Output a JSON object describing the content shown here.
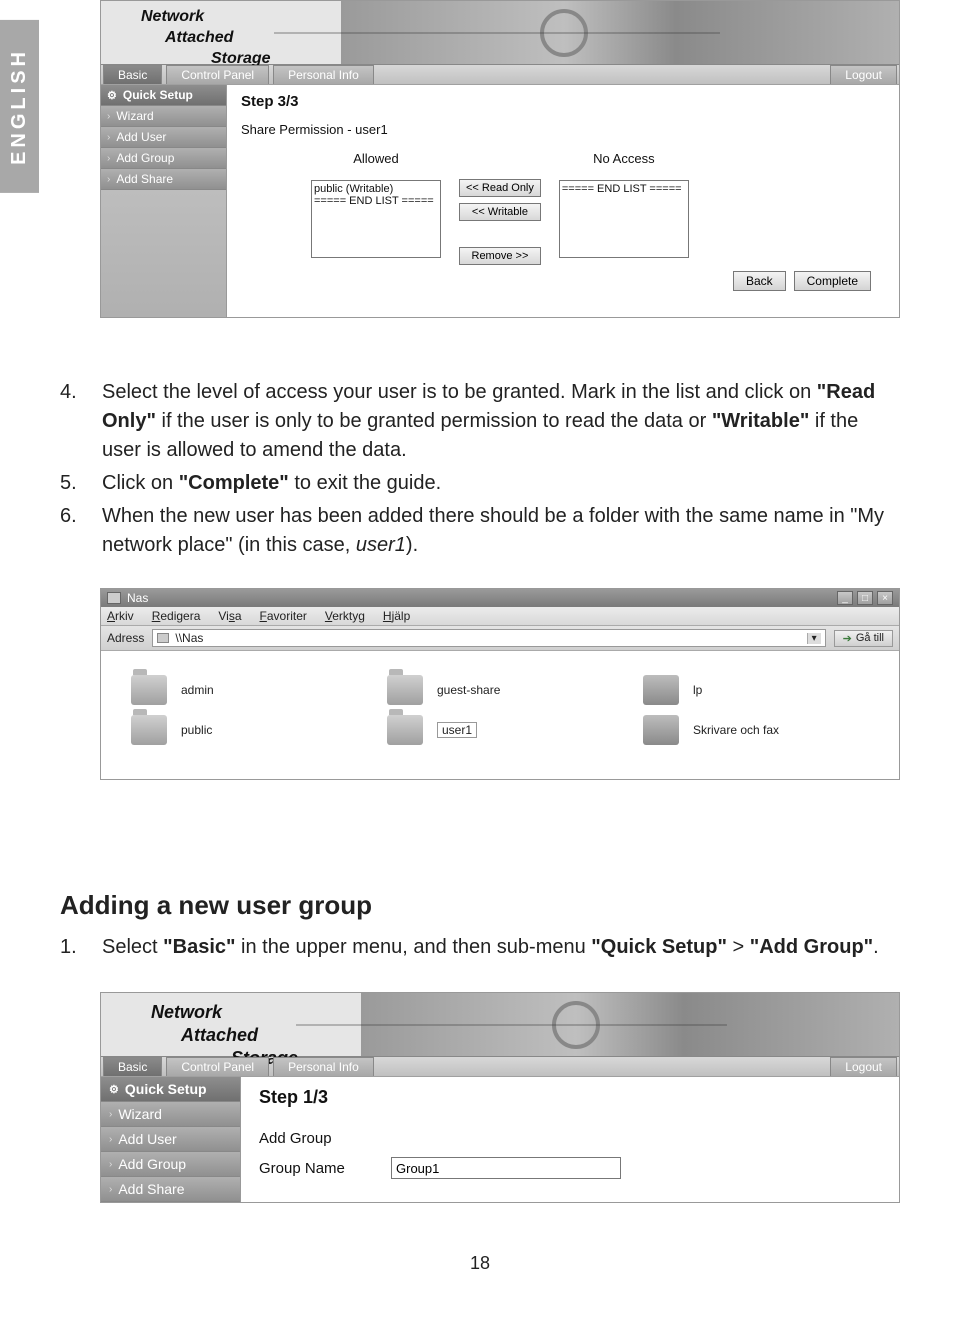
{
  "lang_tab": "ENGLISH",
  "nas": {
    "logo_l1": "Network",
    "logo_l2": "Attached",
    "logo_l3": "Storage",
    "tabs": {
      "basic": "Basic",
      "control_panel": "Control Panel",
      "personal_info": "Personal Info",
      "logout": "Logout"
    },
    "sidebar": {
      "quick_setup": "Quick Setup",
      "wizard": "Wizard",
      "add_user": "Add User",
      "add_group": "Add Group",
      "add_share": "Add Share"
    }
  },
  "shot1": {
    "step": "Step 3/3",
    "title": "Share Permission - user1",
    "col_allowed": "Allowed",
    "col_noaccess": "No Access",
    "allowed_items": [
      "public (Writable)",
      "===== END LIST ====="
    ],
    "noaccess_items": [
      "===== END LIST ====="
    ],
    "btn_readonly": "<< Read Only",
    "btn_writable": "<< Writable",
    "btn_remove": "Remove >>",
    "btn_back": "Back",
    "btn_complete": "Complete"
  },
  "doc": {
    "li4_num": "4.",
    "li4_text_a": "Select the level of access your user is to be granted. Mark in the list and click on ",
    "li4_text_b": "\"Read Only\"",
    "li4_text_c": " if the user is only to be granted permission to read the data or ",
    "li4_text_d": "\"Writable\"",
    "li4_text_e": " if the user is allowed to amend the data.",
    "li5_num": "5.",
    "li5_text_a": "Click on ",
    "li5_text_b": "\"Complete\"",
    "li5_text_c": " to exit the guide.",
    "li6_num": "6.",
    "li6_text_a": "When the new user has been added there should be a folder with the same name in \"My network place\" (in this case, ",
    "li6_text_b": "user1",
    "li6_text_c": ")."
  },
  "explorer": {
    "title": "Nas",
    "menu": {
      "arkiv": "Arkiv",
      "redigera": "Redigera",
      "visa": "Visa",
      "favoriter": "Favoriter",
      "verktyg": "Verktyg",
      "hjalp": "Hjälp"
    },
    "menu_u": {
      "arkiv": "A",
      "redigera": "R",
      "visa": "V",
      "favoriter": "F",
      "verktyg": "V",
      "hjalp": "H"
    },
    "addr_label": "Adress",
    "addr_value": "\\\\Nas",
    "go_label": "Gå till",
    "items": {
      "admin": "admin",
      "guest_share": "guest-share",
      "lp": "lp",
      "public": "public",
      "user1": "user1",
      "skrivare": "Skrivare och fax"
    }
  },
  "section_heading": "Adding a new user group",
  "doc2": {
    "li1_num": "1.",
    "li1_a": "Select ",
    "li1_b": "\"Basic\"",
    "li1_c": " in the upper menu, and then sub-menu ",
    "li1_d": "\"Quick Setup\"",
    "li1_e": " > ",
    "li1_f": "\"Add Group\"",
    "li1_g": "."
  },
  "shot2": {
    "step": "Step 1/3",
    "title": "Add Group",
    "field_label": "Group Name",
    "field_value": "Group1"
  },
  "page_number": "18"
}
